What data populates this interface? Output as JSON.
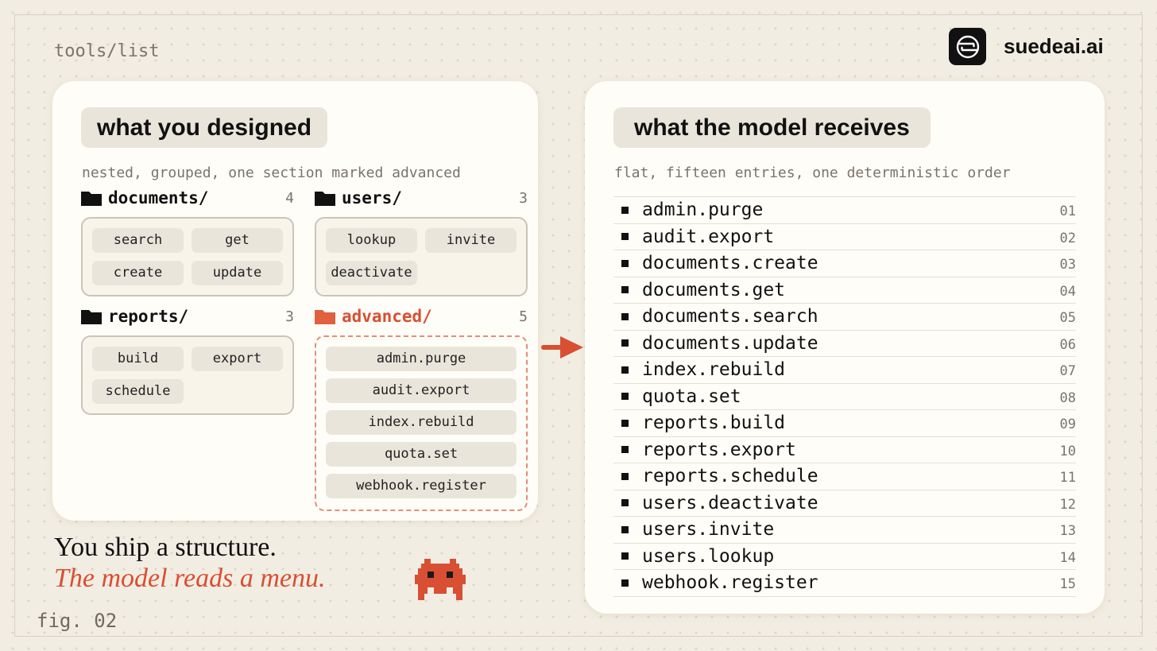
{
  "header": {
    "path_label": "tools/list",
    "brand_name": "suedeai.ai",
    "brand_icon": "suedeai-logo-icon"
  },
  "left_panel": {
    "title": "what you designed",
    "subtitle": "nested, grouped, one section marked advanced",
    "groups": [
      {
        "name": "documents/",
        "count": "4",
        "items": [
          "search",
          "get",
          "create",
          "update"
        ]
      },
      {
        "name": "users/",
        "count": "3",
        "items": [
          "lookup",
          "invite",
          "deactivate"
        ]
      },
      {
        "name": "reports/",
        "count": "3",
        "items": [
          "build",
          "export",
          "schedule"
        ]
      },
      {
        "name": "advanced/",
        "count": "5",
        "items": [
          "admin.purge",
          "audit.export",
          "index.rebuild",
          "quota.set",
          "webhook.register"
        ]
      }
    ]
  },
  "right_panel": {
    "title": "what the model receives",
    "subtitle": "flat, fifteen entries, one deterministic order",
    "entries": [
      {
        "name": "admin.purge",
        "num": "01"
      },
      {
        "name": "audit.export",
        "num": "02"
      },
      {
        "name": "documents.create",
        "num": "03"
      },
      {
        "name": "documents.get",
        "num": "04"
      },
      {
        "name": "documents.search",
        "num": "05"
      },
      {
        "name": "documents.update",
        "num": "06"
      },
      {
        "name": "index.rebuild",
        "num": "07"
      },
      {
        "name": "quota.set",
        "num": "08"
      },
      {
        "name": "reports.build",
        "num": "09"
      },
      {
        "name": "reports.export",
        "num": "10"
      },
      {
        "name": "reports.schedule",
        "num": "11"
      },
      {
        "name": "users.deactivate",
        "num": "12"
      },
      {
        "name": "users.invite",
        "num": "13"
      },
      {
        "name": "users.lookup",
        "num": "14"
      },
      {
        "name": "webhook.register",
        "num": "15"
      }
    ]
  },
  "caption": {
    "line1": "You ship a structure.",
    "line2": "The model reads a menu.",
    "fig_label": "fig. 02"
  },
  "colors": {
    "background": "#f2ede2",
    "card": "#fffdf8",
    "accent": "#d84f33",
    "chip": "#e9e5da",
    "muted_text": "#7a7469"
  }
}
